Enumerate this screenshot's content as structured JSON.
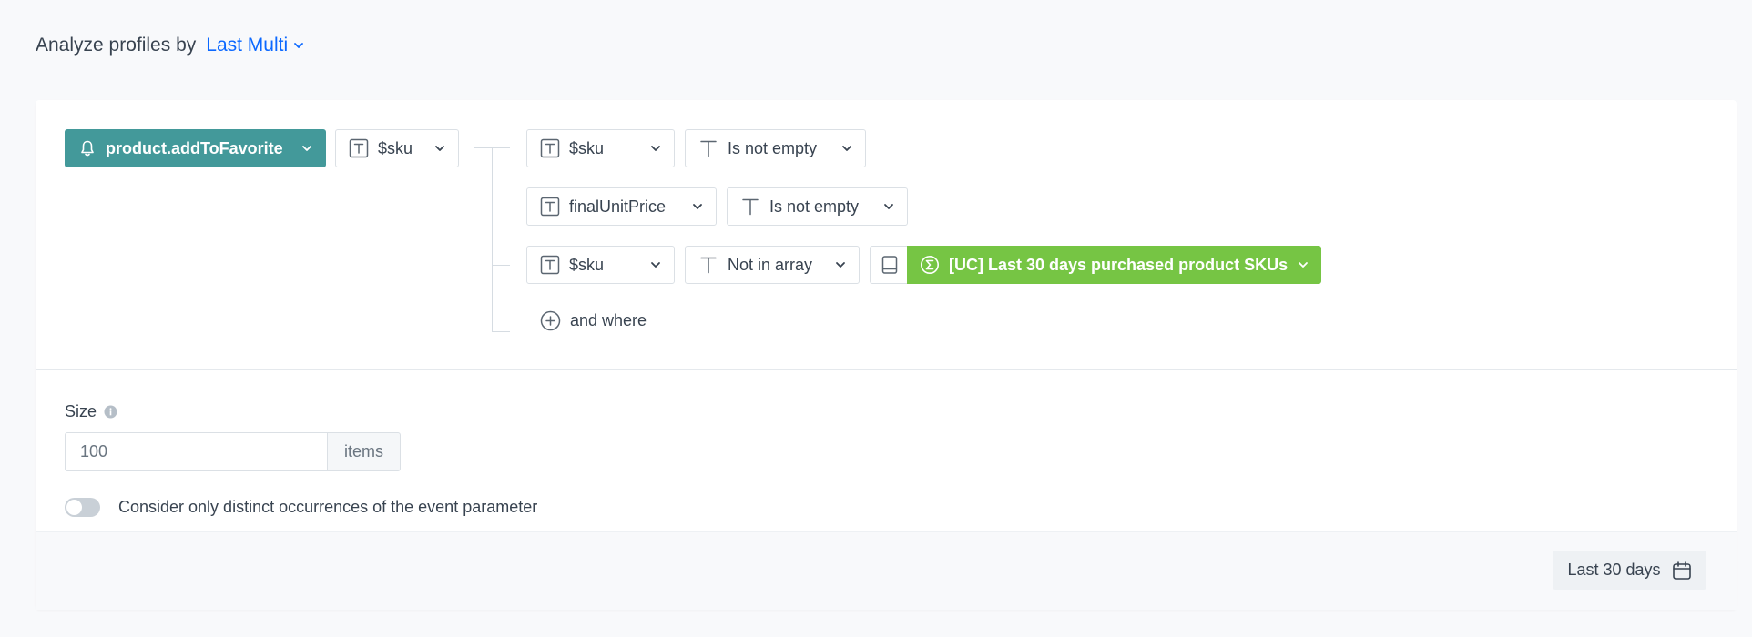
{
  "header": {
    "title": "Analyze profiles by",
    "mode_label": "Last Multi"
  },
  "event": {
    "label": "product.addToFavorite",
    "param_label": "$sku"
  },
  "filters": [
    {
      "param": "$sku",
      "operator": "Is not empty"
    },
    {
      "param": "finalUnitPrice",
      "operator": "Is not empty"
    },
    {
      "param": "$sku",
      "operator": "Not in array",
      "value": "[UC] Last 30 days purchased product SKUs"
    }
  ],
  "and_where_label": "and where",
  "size": {
    "label": "Size",
    "value": "100",
    "suffix": "items"
  },
  "distinct_toggle": {
    "label": "Consider only distinct occurrences of the event parameter",
    "checked": false
  },
  "date_range_label": "Last 30 days",
  "colors": {
    "event": "#43999a",
    "value_green": "#76c544",
    "accent_blue": "#0b68ff"
  }
}
